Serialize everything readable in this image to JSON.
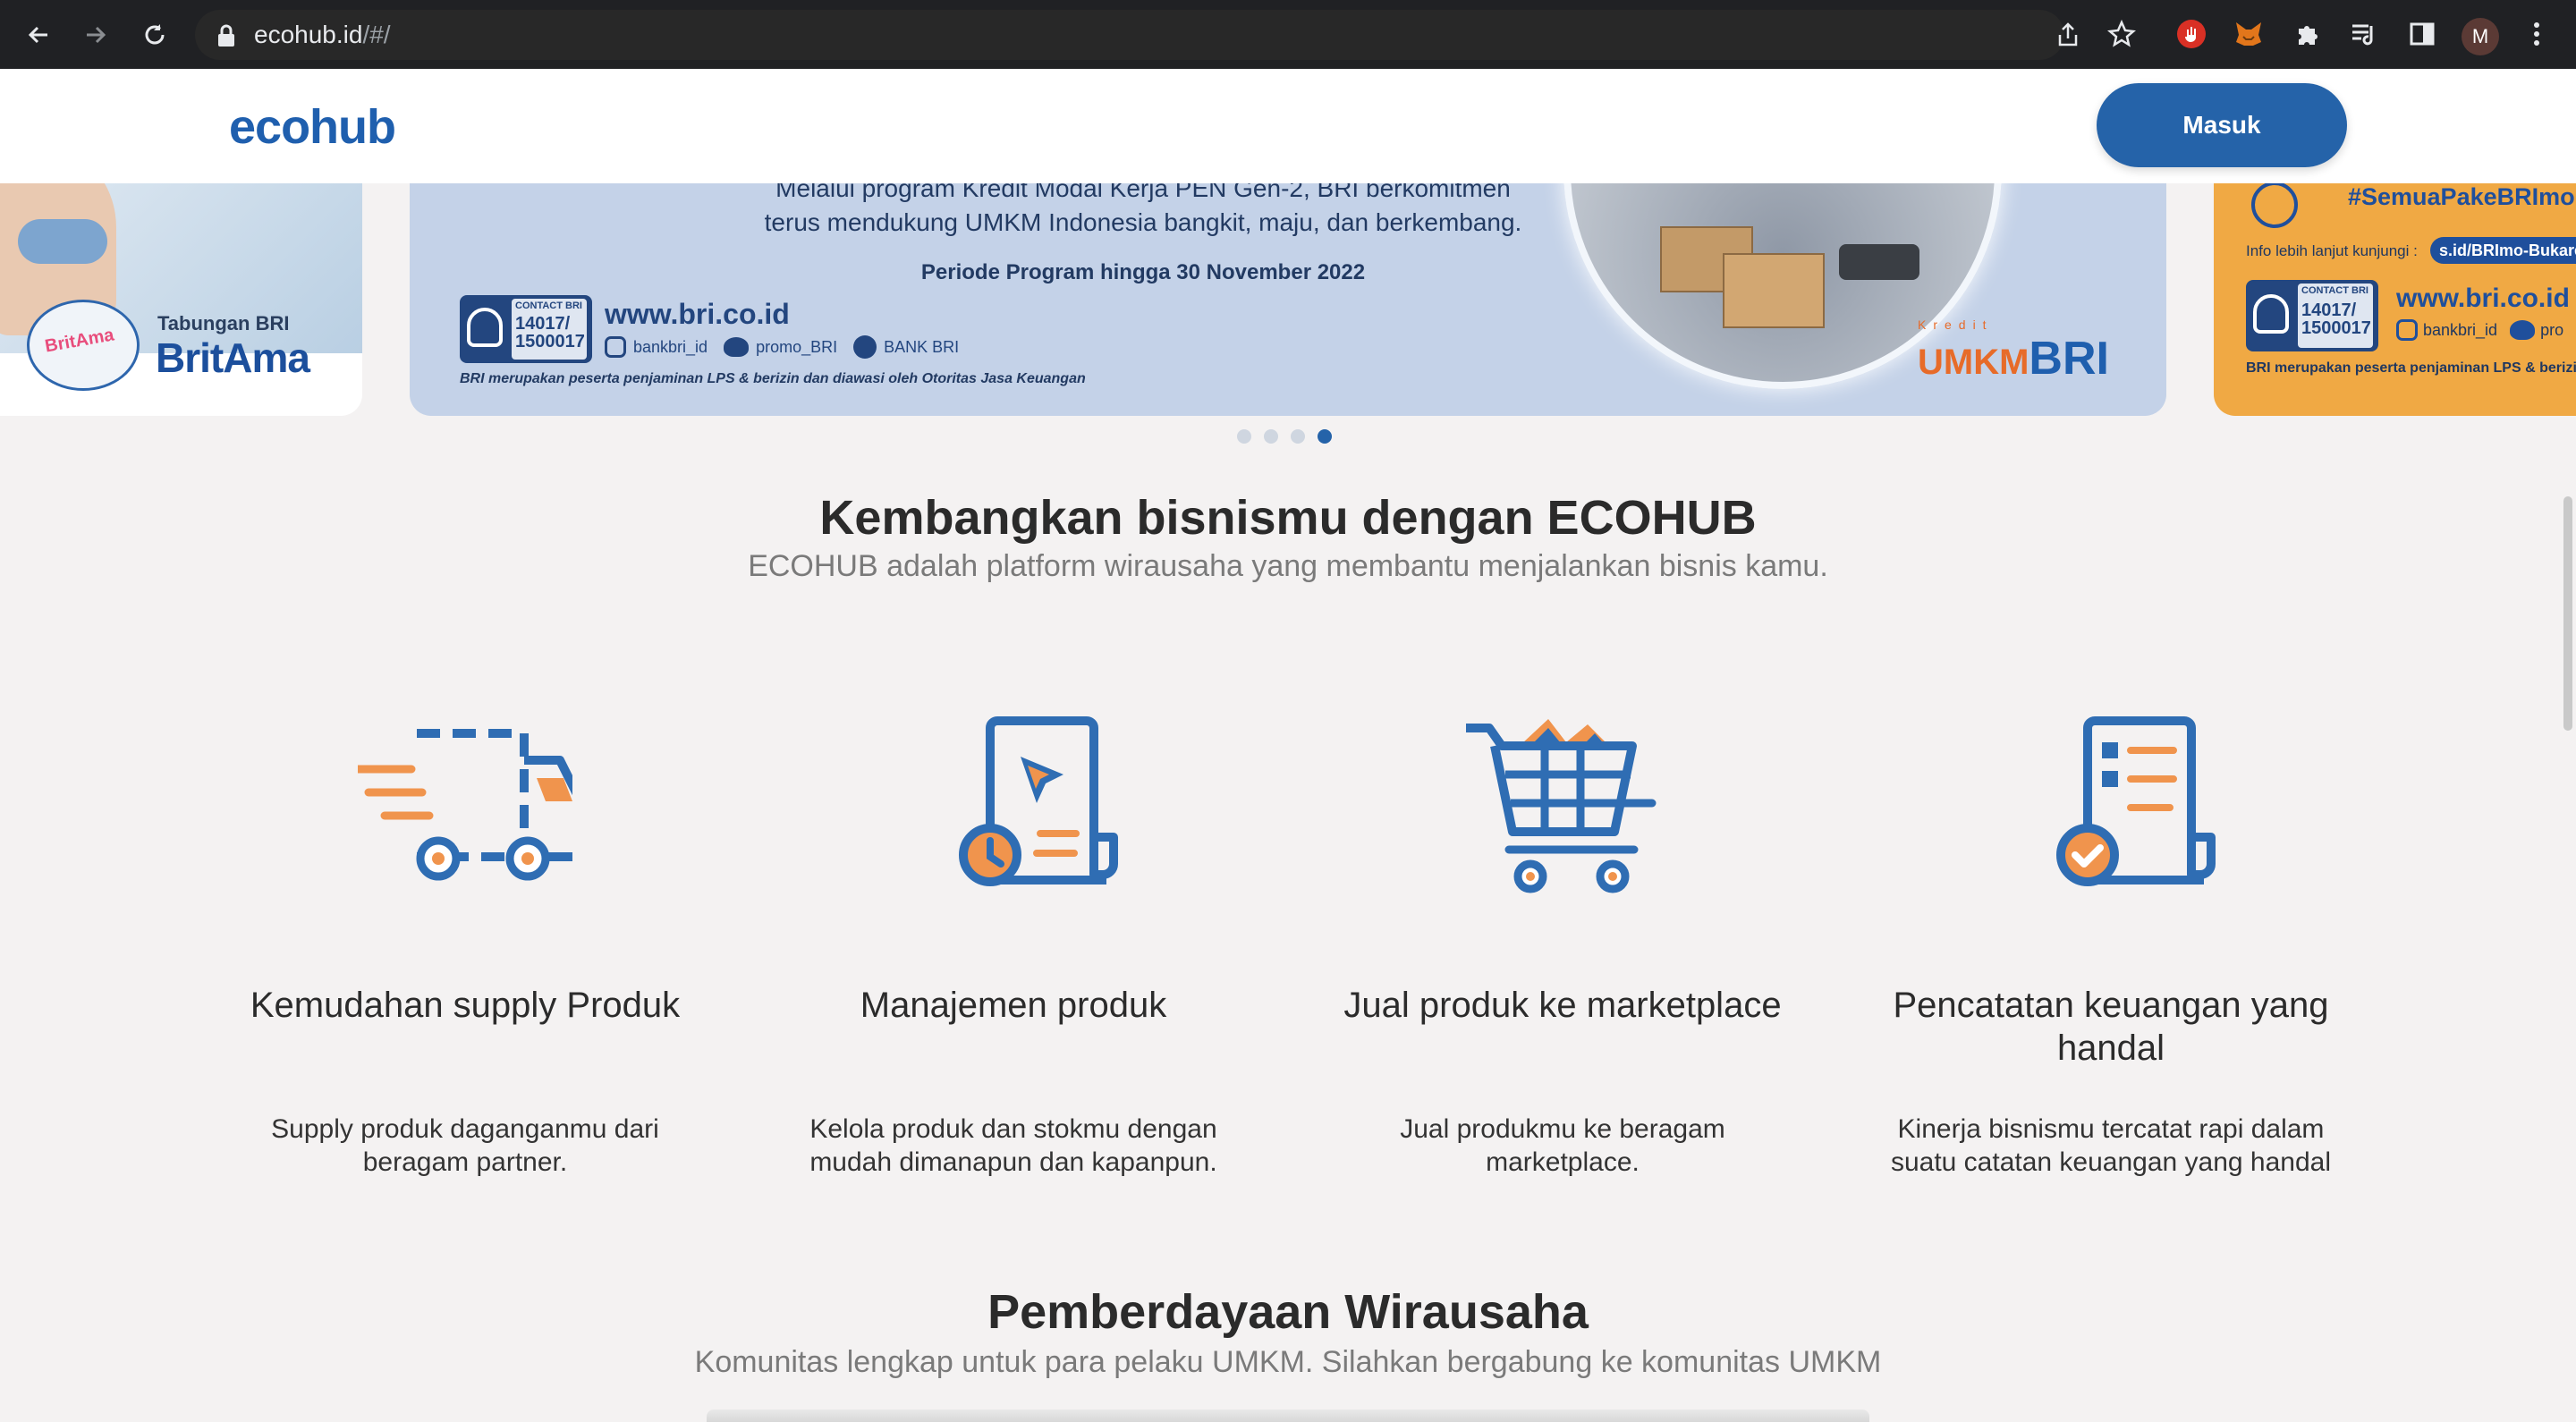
{
  "browser": {
    "url_host": "ecohub.id",
    "url_path": "/#/",
    "avatar_letter": "M",
    "toolbar_icons": [
      "back-icon",
      "forward-icon",
      "reload-icon",
      "lock-icon",
      "share-icon",
      "star-icon",
      "extension-stop-icon",
      "extension-fox-icon",
      "puzzle-icon",
      "media-icon",
      "sidepanel-icon",
      "menu-dots-icon"
    ]
  },
  "header": {
    "logo": "ecohub",
    "login_label": "Masuk",
    "brand_color": "#2563a9"
  },
  "banner": {
    "left": {
      "line1": "Tabungan BRI",
      "brand": "BritAma"
    },
    "center": {
      "line1": "Melalui program Kredit Modal Kerja PEN Gen-2, BRI berkomitmen",
      "line2": "terus mendukung UMKM Indonesia bangkit, maju, dan berkembang.",
      "period": "Periode Program hingga 30 November 2022",
      "contact_label": "CONTACT BRI",
      "contact_num": "14017/ 1500017",
      "website": "www.bri.co.id",
      "social_ig": "bankbri_id",
      "social_tw": "promo_BRI",
      "social_fb": "BANK BRI",
      "footnote": "BRI merupakan peserta penjaminan LPS & berizin dan diawasi oleh Otoritas Jasa Keuangan",
      "brand_small": "Kredit",
      "brand_umkm": "UMKM",
      "brand_bri": "BRI"
    },
    "right": {
      "hashtag": "#SemuaPakeBRImo",
      "info": "Info lebih lanjut kunjungi :",
      "link": "s.id/BRImo-Bukare",
      "contact_label": "CONTACT BRI",
      "contact_num": "14017/ 1500017",
      "website": "www.bri.co.id",
      "social_ig": "bankbri_id",
      "social_tw": "pro",
      "footnote": "BRI merupakan peserta penjaminan LPS & berizin"
    },
    "dots_total": 4,
    "dots_active_index": 3
  },
  "section1": {
    "title": "Kembangkan bisnismu dengan ECOHUB",
    "subtitle": "ECOHUB adalah platform wirausaha yang membantu menjalankan bisnis kamu."
  },
  "features": [
    {
      "title": "Kemudahan supply Produk",
      "desc": "Supply produk daganganmu dari beragam partner.",
      "icon": "delivery-truck-icon"
    },
    {
      "title": "Manajemen produk",
      "desc": "Kelola produk dan stokmu dengan mudah dimanapun dan kapanpun.",
      "icon": "product-management-icon"
    },
    {
      "title": "Jual produk ke marketplace",
      "desc": "Jual produkmu ke beragam marketplace.",
      "icon": "shopping-cart-icon"
    },
    {
      "title": "Pencatatan keuangan yang handal",
      "desc": "Kinerja bisnismu tercatat rapi dalam suatu catatan keuangan yang handal",
      "icon": "financial-record-icon"
    }
  ],
  "section2": {
    "title": "Pemberdayaan Wirausaha",
    "subtitle": "Komunitas lengkap untuk para pelaku UMKM. Silahkan bergabung ke komunitas UMKM"
  },
  "colors": {
    "icon_blue": "#2f6db3",
    "icon_orange": "#f0944d",
    "page_bg": "#f4f2f2"
  }
}
